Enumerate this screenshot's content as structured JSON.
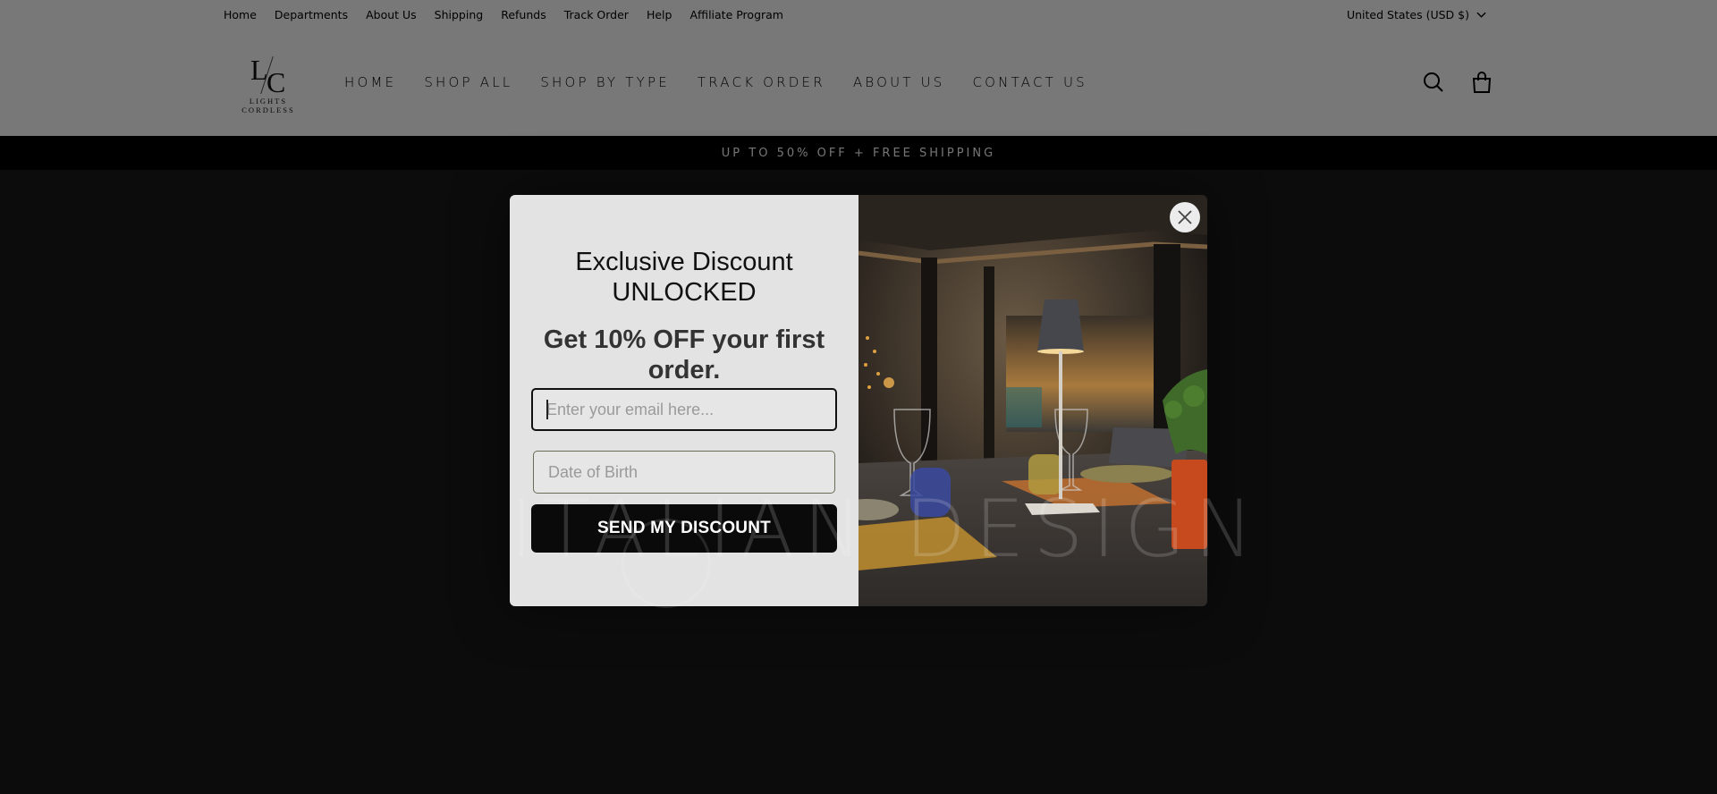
{
  "utility_bar": {
    "links": [
      "Home",
      "Departments",
      "About Us",
      "Shipping",
      "Refunds",
      "Track Order",
      "Help",
      "Affiliate Program"
    ],
    "currency": "United States (USD $)"
  },
  "header": {
    "logo": {
      "monogram_left": "L",
      "monogram_right": "C",
      "wordmark": "LIGHTS CORDLESS"
    },
    "nav": [
      "HOME",
      "SHOP ALL",
      "SHOP BY TYPE",
      "TRACK ORDER",
      "ABOUT US",
      "CONTACT US"
    ],
    "icons": [
      "search-icon",
      "cart-icon"
    ]
  },
  "announcement": "UP TO 50% OFF + FREE SHIPPING",
  "hero": {
    "watermark": "ITALIAN DESIGN"
  },
  "popup": {
    "headline_line1": "Exclusive Discount",
    "headline_line2": "UNLOCKED",
    "subhead": "Get 10% OFF your first order.",
    "email": {
      "value": "",
      "placeholder": "Enter your email here..."
    },
    "dob": {
      "value": "",
      "placeholder": "Date of Birth"
    },
    "submit_label": "SEND MY DISCOUNT",
    "image_alt": "Cordless table lamp on a dining table at dusk",
    "close_icon": "close-icon"
  },
  "colors": {
    "announcement_bg": "#000000",
    "popup_panel_bg": "#e3e3e3",
    "button_bg": "#0a0a0a",
    "button_text": "#ffffff"
  }
}
